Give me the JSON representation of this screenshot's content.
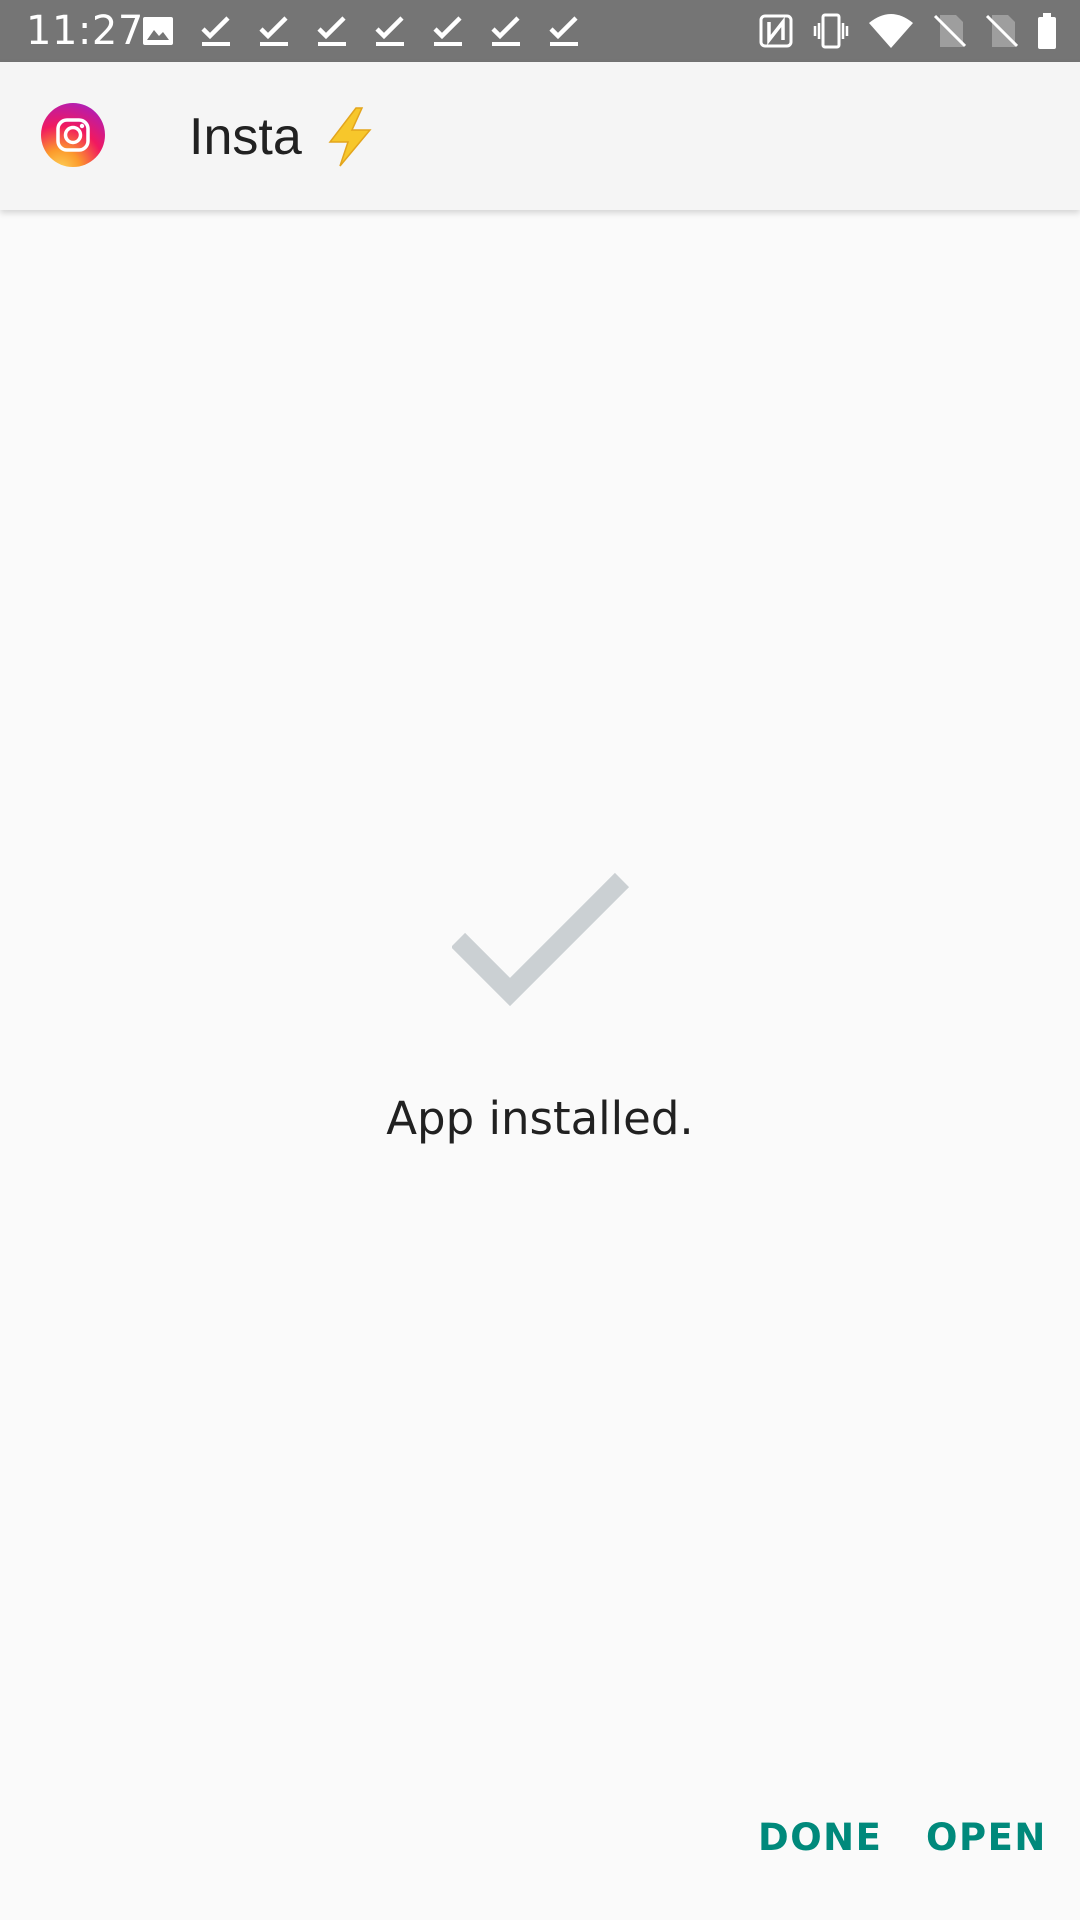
{
  "status_bar": {
    "time": "11:27",
    "left_icons": [
      "image-icon",
      "check-icon",
      "check-icon",
      "check-icon",
      "check-icon",
      "check-icon",
      "check-icon",
      "check-icon"
    ],
    "right_icons": [
      "nfc-icon",
      "vibrate-icon",
      "wifi-icon",
      "no-sim-icon",
      "no-sim-icon",
      "battery-icon"
    ]
  },
  "app_bar": {
    "app_name": "Insta",
    "emoji": "⚡",
    "icon": "instagram-icon"
  },
  "main": {
    "status_message": "App installed."
  },
  "actions": {
    "done_label": "DONE",
    "open_label": "OPEN",
    "accent_color": "#00897b"
  }
}
